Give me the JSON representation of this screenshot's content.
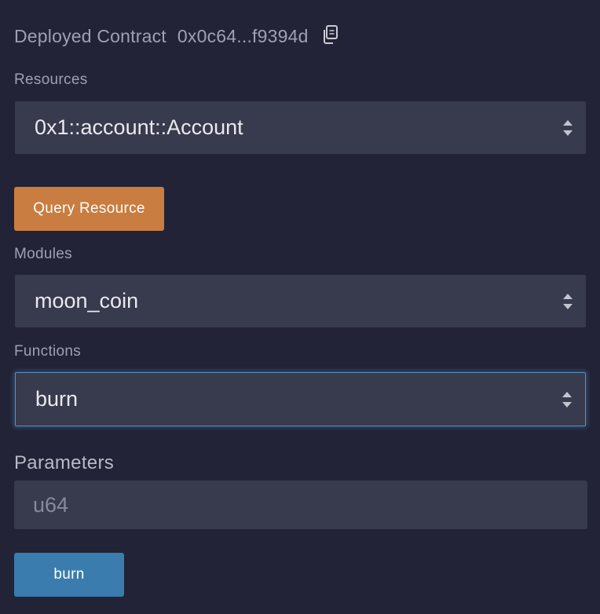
{
  "header": {
    "title": "Deployed Contract",
    "address": "0x0c64...f9394d",
    "copy_icon": "copy-icon"
  },
  "resources": {
    "label": "Resources",
    "selected": "0x1::account::Account"
  },
  "query_button": {
    "label": "Query Resource"
  },
  "modules": {
    "label": "Modules",
    "selected": "moon_coin"
  },
  "functions": {
    "label": "Functions",
    "selected": "burn"
  },
  "parameters": {
    "label": "Parameters",
    "placeholder": "u64"
  },
  "action_button": {
    "label": "burn"
  },
  "colors": {
    "background": "#222336",
    "field": "#383a4d",
    "query_button": "#c97d40",
    "action_button": "#3a7cad",
    "focus_ring": "#5b8fb8"
  }
}
